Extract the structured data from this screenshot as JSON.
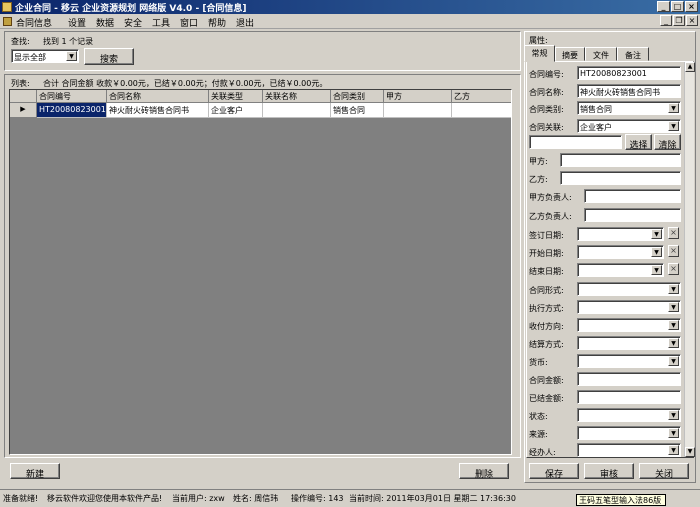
{
  "window": {
    "title": "企业合同 - 移云 企业资源规划 网络版 V4.0 - [合同信息]"
  },
  "menu": [
    "合同信息",
    "设置",
    "数据",
    "安全",
    "工具",
    "窗口",
    "帮助",
    "退出"
  ],
  "find": {
    "label": "查找:",
    "result": "找到 1 个记录",
    "filter_value": "显示全部",
    "search_button": "搜索"
  },
  "list": {
    "label": "列表:",
    "summary": "合计 合同金额 收款￥0.00元，已结￥0.00元；付款￥0.00元，已结￥0.00元。",
    "columns": [
      "合同编号",
      "合同名称",
      "关联类型",
      "关联名称",
      "合同类别",
      "甲方",
      "乙方"
    ],
    "rows": [
      [
        "HT20080823001",
        "神火耐火砖销售合同书",
        "企业客户",
        "",
        "销售合同",
        "",
        ""
      ]
    ]
  },
  "buttons": {
    "new": "新建",
    "delete": "删除",
    "save": "保存",
    "review": "审核",
    "close": "关闭",
    "select": "选择",
    "clear": "清除"
  },
  "properties": {
    "header": "属性:",
    "tabs": [
      "常规",
      "摘要",
      "文件",
      "备注"
    ],
    "fields": {
      "contract_no": {
        "label": "合同编号:",
        "value": "HT20080823001"
      },
      "contract_name": {
        "label": "合同名称:",
        "value": "神火耐火砖销售合同书"
      },
      "contract_type": {
        "label": "合同类别:",
        "value": "销售合同"
      },
      "contract_link": {
        "label": "合同关联:",
        "value": "企业客户"
      },
      "link_name": {
        "value": ""
      },
      "party_a": {
        "label": "甲方:",
        "value": ""
      },
      "party_b": {
        "label": "乙方:",
        "value": ""
      },
      "party_a_rep": {
        "label": "甲方负责人:",
        "value": ""
      },
      "party_b_rep": {
        "label": "乙方负责人:",
        "value": ""
      },
      "sign_date": {
        "label": "签订日期:",
        "value": ""
      },
      "start_date": {
        "label": "开始日期:",
        "value": ""
      },
      "end_date": {
        "label": "结束日期:",
        "value": ""
      },
      "form": {
        "label": "合同形式:",
        "value": ""
      },
      "exec_method": {
        "label": "执行方式:",
        "value": ""
      },
      "pay_direction": {
        "label": "收付方向:",
        "value": ""
      },
      "settle_method": {
        "label": "结算方式:",
        "value": ""
      },
      "currency": {
        "label": "货币:",
        "value": ""
      },
      "amount": {
        "label": "合同金额:",
        "value": ""
      },
      "settled_amount": {
        "label": "已结金额:",
        "value": ""
      },
      "status": {
        "label": "状态:",
        "value": ""
      },
      "source": {
        "label": "来源:",
        "value": ""
      },
      "handler": {
        "label": "经办人:",
        "value": ""
      }
    }
  },
  "status": {
    "ready": "准备就绪!",
    "welcome": "移云软件欢迎您使用本软件产品!",
    "current_user": "当前用户: zxw",
    "name": "姓名: 周信玮",
    "op_no": "操作编号: 143",
    "time": "当前时间: 2011年03月01日 星期二 17:36:30"
  },
  "ime": "王码五笔型输入法86版"
}
